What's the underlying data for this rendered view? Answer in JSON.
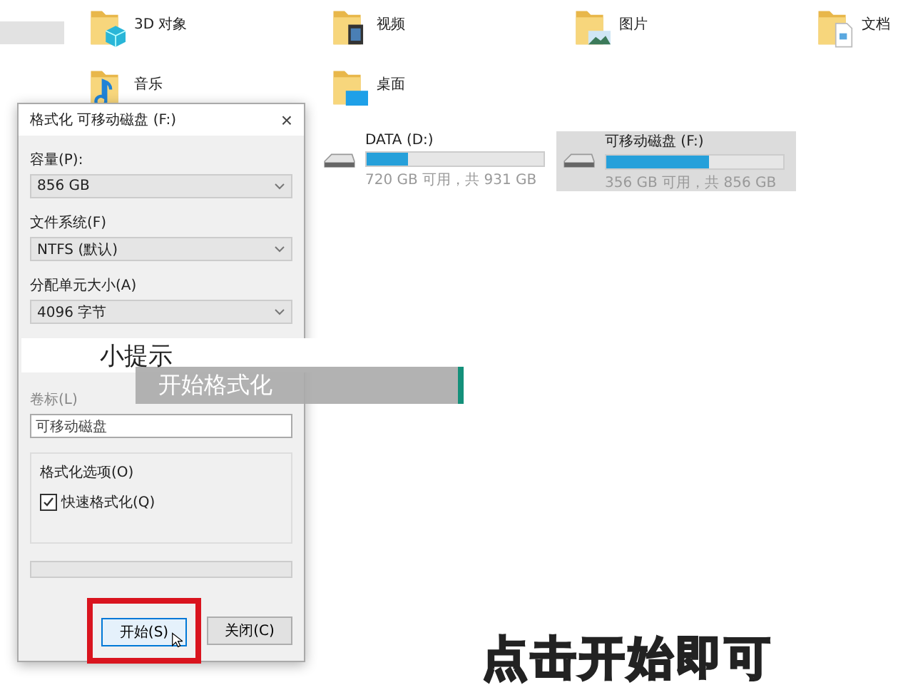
{
  "explorer": {
    "folders": [
      {
        "name": "3D 对象",
        "kind": "cube"
      },
      {
        "name": "视频",
        "kind": "film"
      },
      {
        "name": "图片",
        "kind": "picture"
      },
      {
        "name": "文档",
        "kind": "document"
      },
      {
        "name": "音乐",
        "kind": "music"
      },
      {
        "name": "桌面",
        "kind": "desktop"
      }
    ],
    "drives": [
      {
        "name": "DATA (D:)",
        "level": 0.23,
        "free_text": "720 GB 可用，共 931 GB",
        "selected": false
      },
      {
        "name": "可移动磁盘 (F:)",
        "level": 0.58,
        "free_text": "356 GB 可用，共 856 GB",
        "selected": true
      }
    ]
  },
  "dialog": {
    "title": "格式化 可移动磁盘 (F:)",
    "close": "×",
    "fields": [
      {
        "label": "容量(P):",
        "value": "856 GB"
      },
      {
        "label": "文件系统(F)",
        "value": "NTFS (默认)"
      },
      {
        "label": "分配单元大小(A)",
        "value": "4096 字节"
      }
    ],
    "volume_label": {
      "label": "卷标(L)",
      "value": "可移动磁盘"
    },
    "options": {
      "title": "格式化选项(O)",
      "quick_format": {
        "label": "快速格式化(Q)",
        "checked": true
      }
    },
    "progress": {
      "level": 0
    },
    "buttons": [
      {
        "label": "开始(S)",
        "marked": true
      },
      {
        "label": "关闭(C)",
        "marked": false
      }
    ]
  },
  "tip": {
    "heading": "小提示",
    "text": "开始格式化"
  },
  "caption": "点击开始即可"
}
